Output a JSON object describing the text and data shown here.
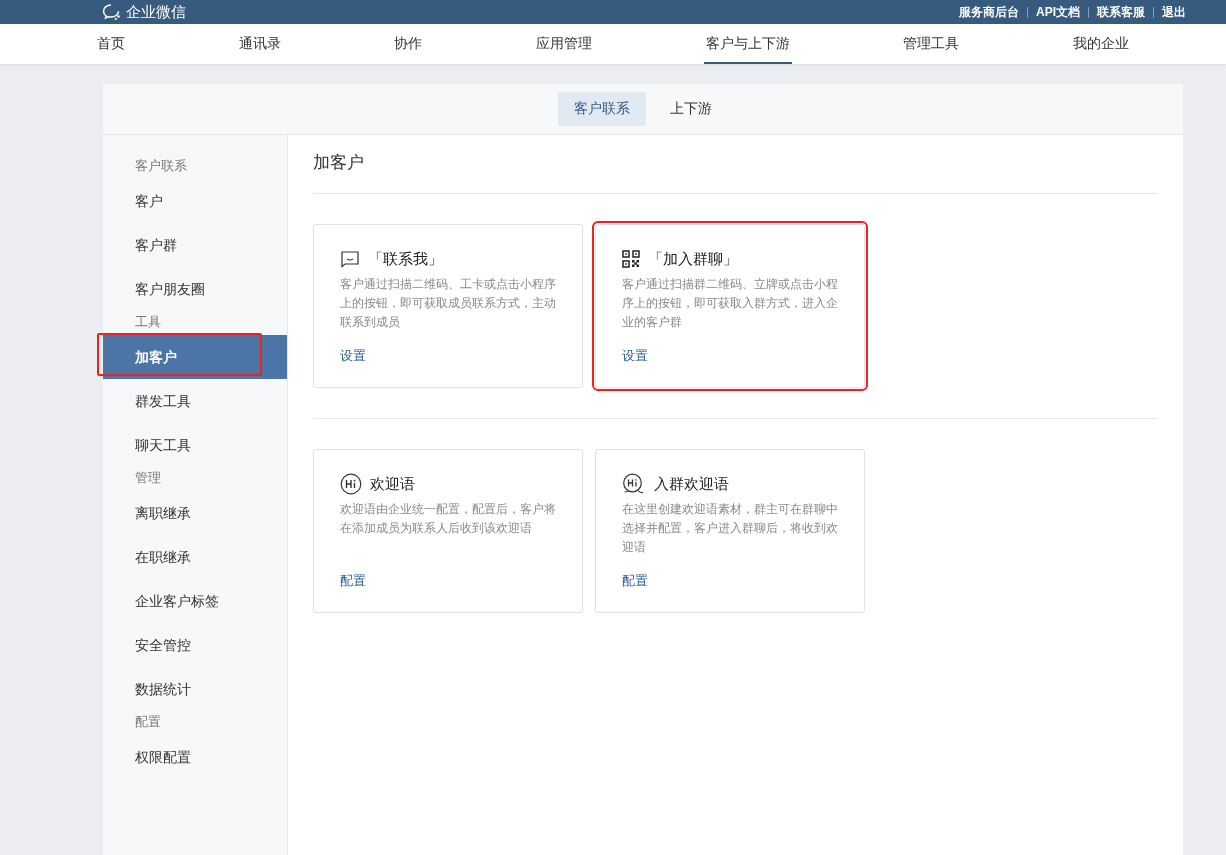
{
  "brand": {
    "name": "企业微信"
  },
  "top_links": [
    "服务商后台",
    "API文档",
    "联系客服",
    "退出"
  ],
  "nav": [
    {
      "label": "首页",
      "selected": false
    },
    {
      "label": "通讯录",
      "selected": false
    },
    {
      "label": "协作",
      "selected": false
    },
    {
      "label": "应用管理",
      "selected": false
    },
    {
      "label": "客户与上下游",
      "selected": true
    },
    {
      "label": "管理工具",
      "selected": false
    },
    {
      "label": "我的企业",
      "selected": false
    }
  ],
  "sub_tabs": [
    {
      "label": "客户联系",
      "selected": true
    },
    {
      "label": "上下游",
      "selected": false
    }
  ],
  "sidebar": {
    "items": [
      {
        "kind": "header",
        "label": "客户联系"
      },
      {
        "kind": "item",
        "label": "客户",
        "selected": false,
        "highlighted": false
      },
      {
        "kind": "item",
        "label": "客户群",
        "selected": false,
        "highlighted": false
      },
      {
        "kind": "item",
        "label": "客户朋友圈",
        "selected": false,
        "highlighted": false
      },
      {
        "kind": "header",
        "label": "工具"
      },
      {
        "kind": "item",
        "label": "加客户",
        "selected": true,
        "highlighted": true
      },
      {
        "kind": "item",
        "label": "群发工具",
        "selected": false,
        "highlighted": false
      },
      {
        "kind": "item",
        "label": "聊天工具",
        "selected": false,
        "highlighted": false
      },
      {
        "kind": "header",
        "label": "管理"
      },
      {
        "kind": "item",
        "label": "离职继承",
        "selected": false,
        "highlighted": false
      },
      {
        "kind": "item",
        "label": "在职继承",
        "selected": false,
        "highlighted": false
      },
      {
        "kind": "item",
        "label": "企业客户标签",
        "selected": false,
        "highlighted": false
      },
      {
        "kind": "item",
        "label": "安全管控",
        "selected": false,
        "highlighted": false
      },
      {
        "kind": "item",
        "label": "数据统计",
        "selected": false,
        "highlighted": false
      },
      {
        "kind": "header",
        "label": "配置"
      },
      {
        "kind": "item",
        "label": "权限配置",
        "selected": false,
        "highlighted": false
      }
    ]
  },
  "content": {
    "title": "加客户",
    "sections": [
      {
        "cards": [
          {
            "kind": "chat",
            "title": "「联系我」",
            "description": "客户通过扫描二维码、工卡或点击小程序上的按钮，即可获取成员联系方式，主动联系到成员",
            "action": "设置",
            "highlighted": false
          },
          {
            "kind": "qr",
            "title": "「加入群聊」",
            "description": "客户通过扫描群二维码、立牌或点击小程序上的按钮，即可获取入群方式，进入企业的客户群",
            "action": "设置",
            "highlighted": true
          }
        ]
      },
      {
        "cards": [
          {
            "kind": "hi",
            "title": "欢迎语",
            "description": "欢迎语由企业统一配置，配置后，客户将在添加成员为联系人后收到该欢迎语",
            "action": "配置",
            "highlighted": false
          },
          {
            "kind": "hi-chat",
            "title": "入群欢迎语",
            "description": "在这里创建欢迎语素材，群主可在群聊中选择并配置，客户进入群聊后，将收到欢迎语",
            "action": "配置",
            "highlighted": false
          }
        ]
      }
    ]
  }
}
